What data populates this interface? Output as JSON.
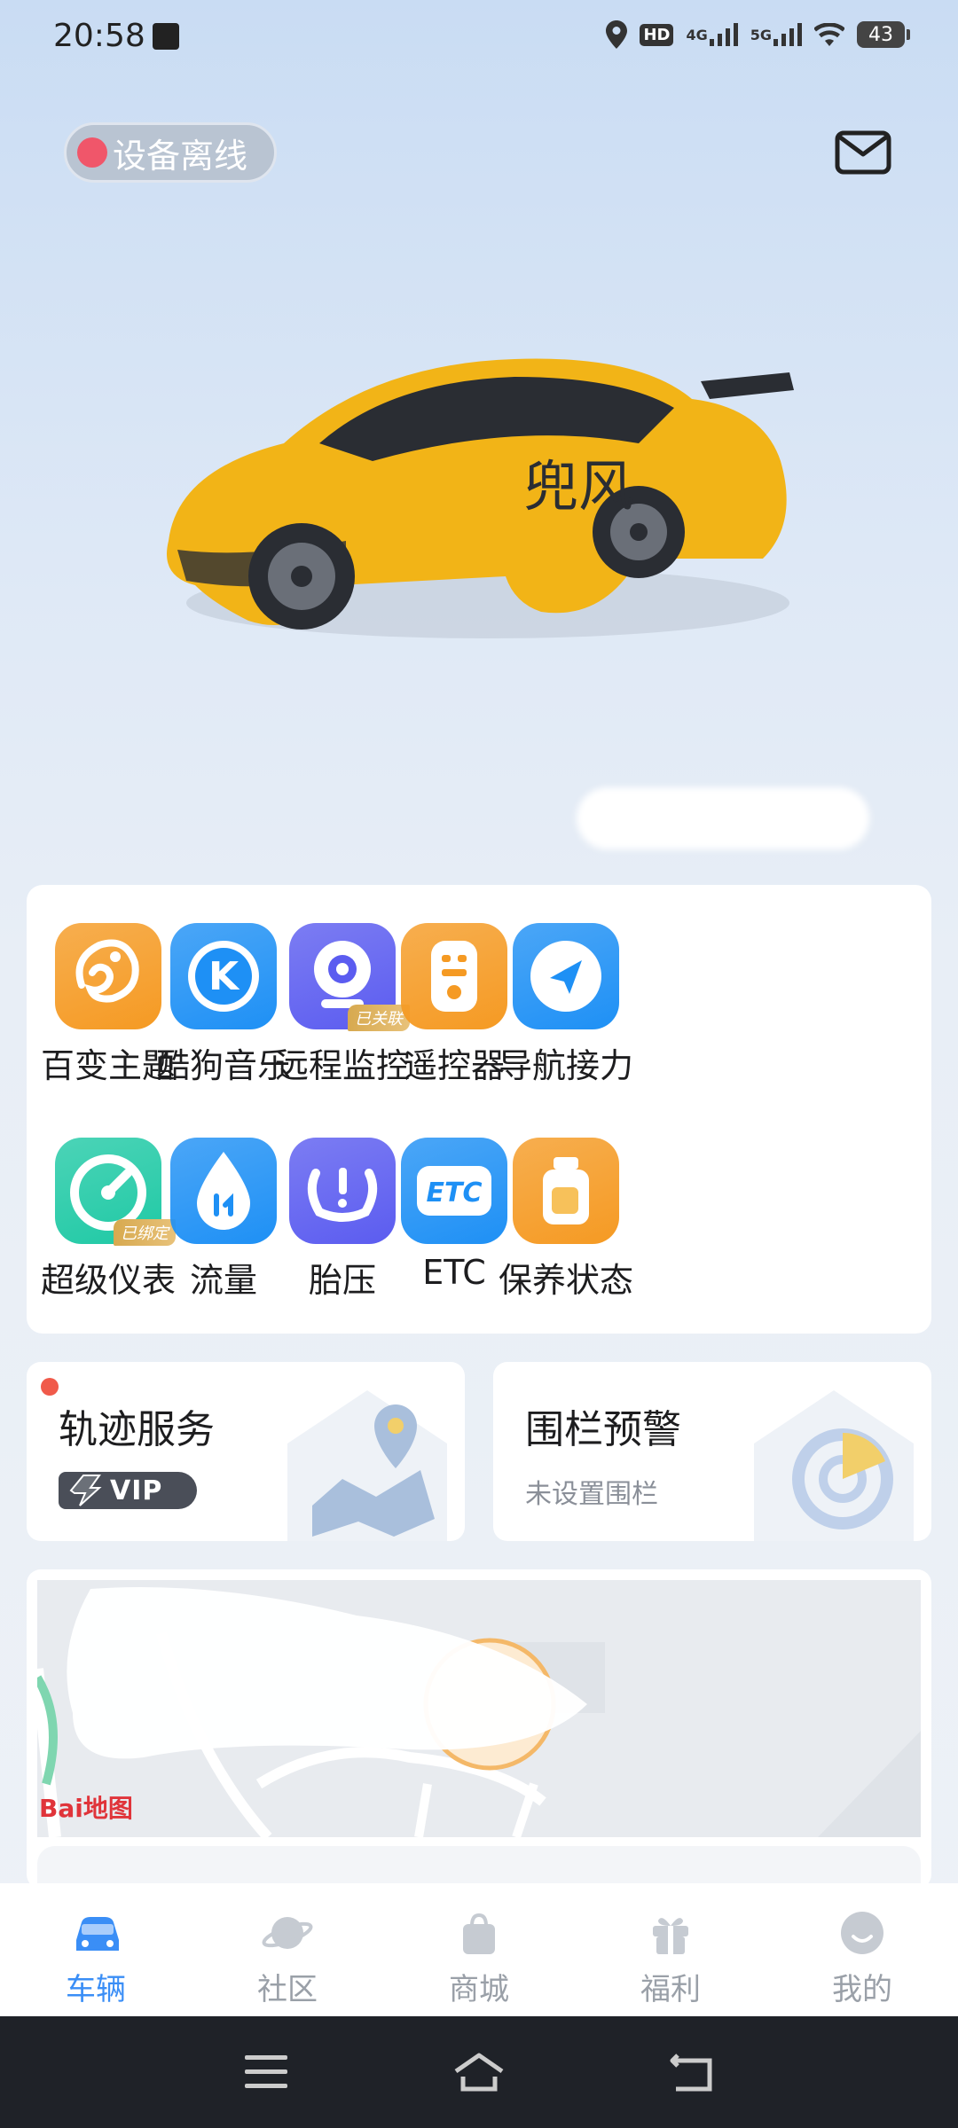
{
  "status_bar": {
    "time": "20:58",
    "network_hd": "HD",
    "network_4g": "4G",
    "network_5g": "5G",
    "battery": "43"
  },
  "header": {
    "device_status": "设备离线",
    "status_color": "#f0566a"
  },
  "car": {
    "name_text": "兜风"
  },
  "features": [
    {
      "label": "百变主题",
      "icon": "chameleon-icon",
      "color": "#f59a23"
    },
    {
      "label": "酷狗音乐",
      "icon": "kugou-icon",
      "color": "#1e90f5"
    },
    {
      "label": "远程监控",
      "icon": "camera-icon",
      "color": "#5b5cf0",
      "badge": "已关联"
    },
    {
      "label": "遥控器",
      "icon": "remote-icon",
      "color": "#f59a23"
    },
    {
      "label": "导航接力",
      "icon": "navigation-icon",
      "color": "#1e90f5"
    },
    {
      "label": "超级仪表",
      "icon": "gauge-icon",
      "color": "#1fc9a5",
      "badge": "已绑定"
    },
    {
      "label": "流量",
      "icon": "data-drop-icon",
      "color": "#1e90f5"
    },
    {
      "label": "胎压",
      "icon": "tire-pressure-icon",
      "color": "#5b5cf0"
    },
    {
      "label": "ETC",
      "icon": "etc-icon",
      "color": "#1e90f5"
    },
    {
      "label": "保养状态",
      "icon": "oil-can-icon",
      "color": "#f59a23"
    }
  ],
  "services": {
    "track": {
      "title": "轨迹服务",
      "badge": "VIP"
    },
    "fence": {
      "title": "围栏预警",
      "subtitle": "未设置围栏"
    }
  },
  "map": {
    "logo": "Bai地图"
  },
  "bottom_nav": [
    {
      "label": "车辆",
      "icon": "car-icon",
      "active": true
    },
    {
      "label": "社区",
      "icon": "planet-icon",
      "active": false
    },
    {
      "label": "商城",
      "icon": "shopping-bag-icon",
      "active": false
    },
    {
      "label": "福利",
      "icon": "gift-icon",
      "active": false
    },
    {
      "label": "我的",
      "icon": "profile-icon",
      "active": false
    }
  ],
  "colors": {
    "accent": "#3a8ef6",
    "orange": "#f59a23",
    "blue": "#1e90f5"
  }
}
